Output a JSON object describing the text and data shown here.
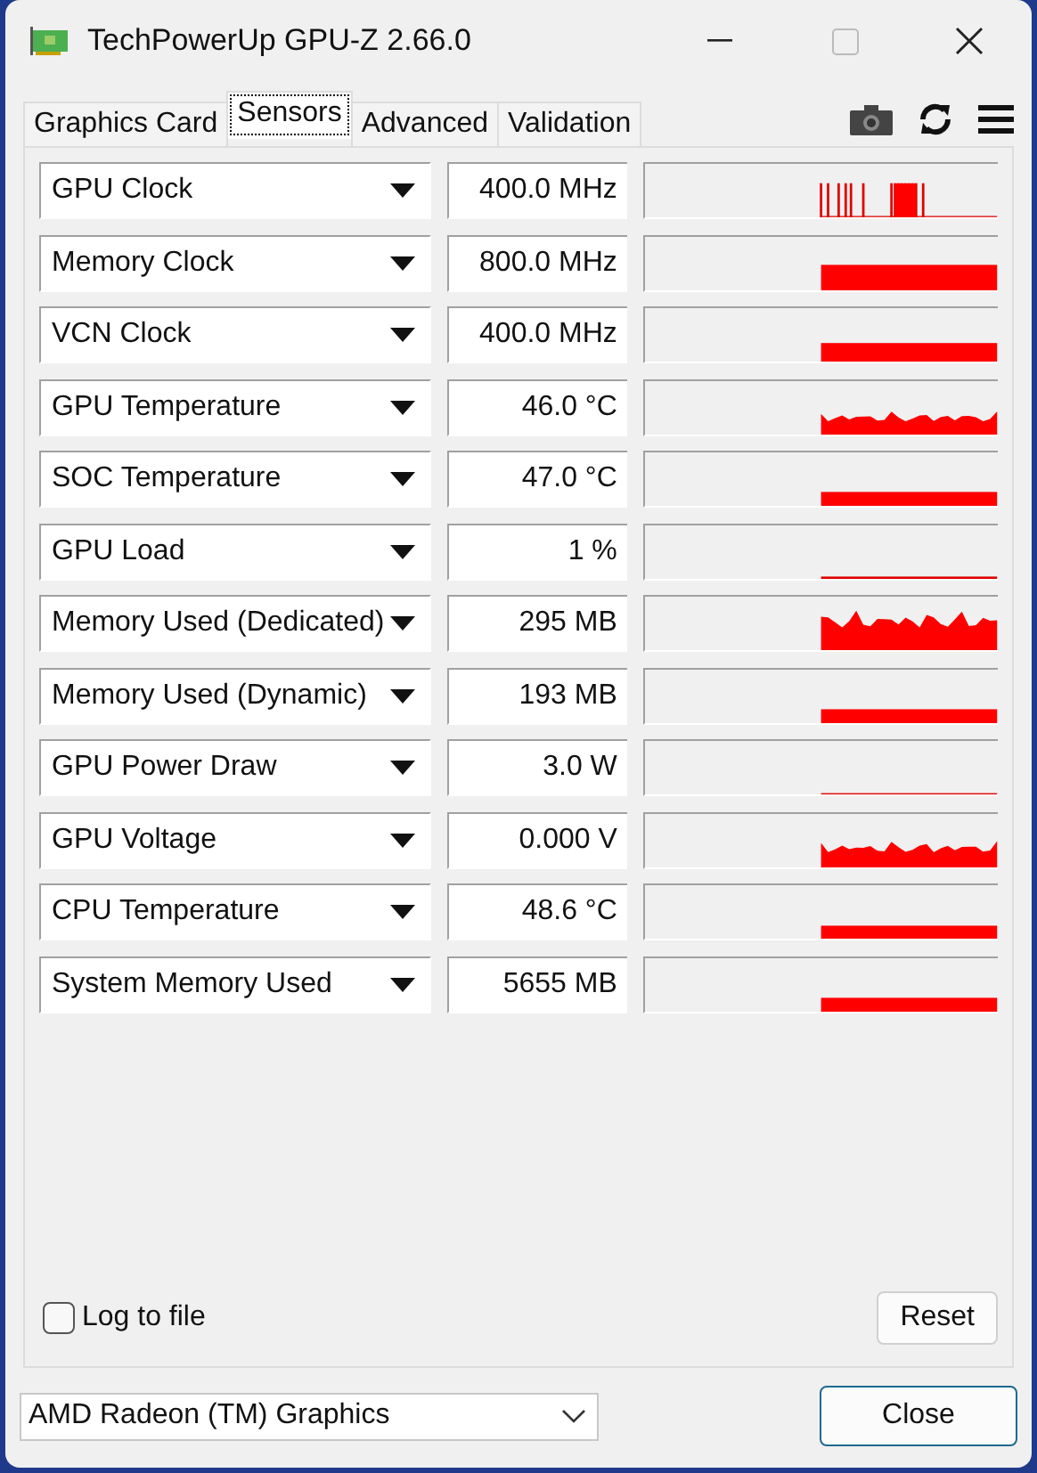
{
  "window": {
    "title": "TechPowerUp GPU-Z 2.66.0"
  },
  "tabs": [
    {
      "label": "Graphics Card",
      "selected": false
    },
    {
      "label": "Sensors",
      "selected": true
    },
    {
      "label": "Advanced",
      "selected": false
    },
    {
      "label": "Validation",
      "selected": false
    }
  ],
  "sensors": [
    {
      "name": "GPU Clock",
      "value": "400.0 MHz",
      "kind": "spikes"
    },
    {
      "name": "Memory Clock",
      "value": "800.0 MHz",
      "kind": "bar"
    },
    {
      "name": "VCN Clock",
      "value": "400.0 MHz",
      "kind": "bar"
    },
    {
      "name": "GPU Temperature",
      "value": "46.0 °C",
      "kind": "rough"
    },
    {
      "name": "SOC Temperature",
      "value": "47.0 °C",
      "kind": "bar"
    },
    {
      "name": "GPU Load",
      "value": "1 %",
      "kind": "line"
    },
    {
      "name": "Memory Used (Dedicated)",
      "value": "295 MB",
      "kind": "rough"
    },
    {
      "name": "Memory Used (Dynamic)",
      "value": "193 MB",
      "kind": "bar"
    },
    {
      "name": "GPU Power Draw",
      "value": "3.0 W",
      "kind": "line"
    },
    {
      "name": "GPU Voltage",
      "value": "0.000 V",
      "kind": "rough"
    },
    {
      "name": "CPU Temperature",
      "value": "48.6 °C",
      "kind": "bar"
    },
    {
      "name": "System Memory Used",
      "value": "5655 MB",
      "kind": "bar"
    }
  ],
  "log_to_file": {
    "label": "Log to file",
    "checked": false
  },
  "buttons": {
    "reset": "Reset",
    "close": "Close"
  },
  "device": {
    "value": "AMD Radeon (TM) Graphics"
  }
}
